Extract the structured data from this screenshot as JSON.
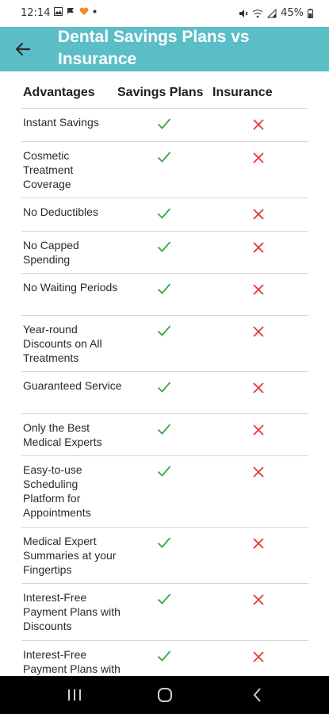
{
  "status_bar": {
    "time": "12:14",
    "left_icons": [
      "image-icon",
      "flag-icon",
      "heart-icon",
      "dot-icon"
    ],
    "right_icons": [
      "mute-icon",
      "wifi-icon",
      "signal-icon"
    ],
    "battery": "45%"
  },
  "app_bar": {
    "title": "Dental Savings Plans vs Insurance",
    "background": "#5bbec6"
  },
  "table": {
    "headers": [
      "Advantages",
      "Savings Plans",
      "Insurance"
    ],
    "check_color": "#3aa845",
    "cross_color": "#e53935",
    "rows": [
      {
        "label": "Instant Savings",
        "savings": true,
        "insurance": false
      },
      {
        "label": "Cosmetic Treatment Coverage",
        "savings": true,
        "insurance": false
      },
      {
        "label": "No Deductibles",
        "savings": true,
        "insurance": false
      },
      {
        "label": "No Capped Spending",
        "savings": true,
        "insurance": false
      },
      {
        "label": "No Waiting Periods",
        "savings": true,
        "insurance": false
      },
      {
        "label": "Year-round Discounts on All Treatments",
        "savings": true,
        "insurance": false
      },
      {
        "label": "Guaranteed Service",
        "savings": true,
        "insurance": false
      },
      {
        "label": "Only the Best Medical Experts",
        "savings": true,
        "insurance": false
      },
      {
        "label": "Easy-to-use Scheduling Platform for Appointments",
        "savings": true,
        "insurance": false
      },
      {
        "label": "Medical Expert Summaries at your Fingertips",
        "savings": true,
        "insurance": false
      },
      {
        "label": "Interest-Free Payment Plans with Discounts",
        "savings": true,
        "insurance": false
      },
      {
        "label": "Interest-Free Payment Plans with Discounts",
        "savings": true,
        "insurance": false
      }
    ]
  },
  "nav_bar": {
    "buttons": [
      "recent-apps-icon",
      "home-icon",
      "back-icon"
    ]
  }
}
